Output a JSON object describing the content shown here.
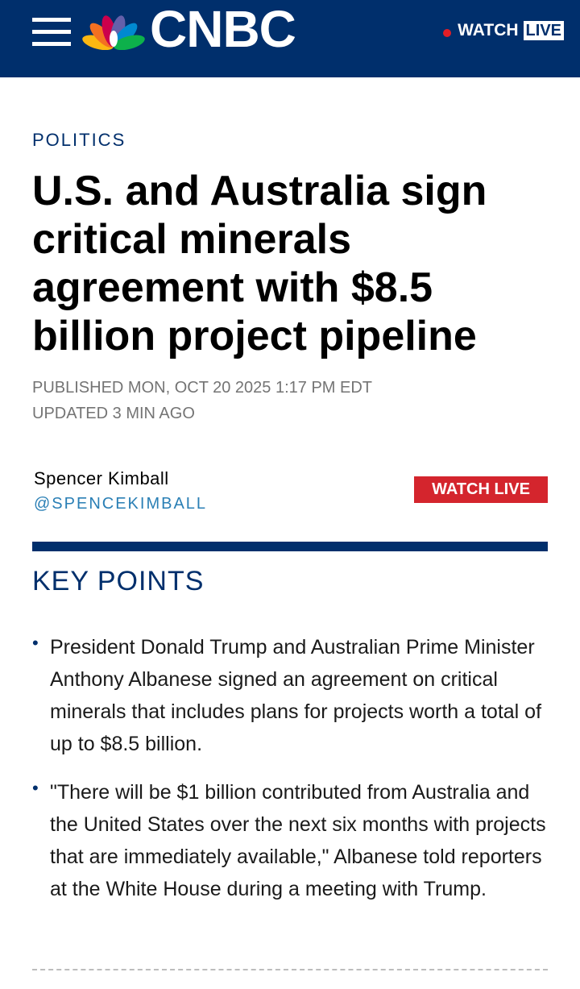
{
  "header": {
    "logo_text": "CNBC",
    "watch_label": "WATCH",
    "live_label": "LIVE"
  },
  "article": {
    "section": "POLITICS",
    "headline": "U.S. and Australia sign critical minerals agreement with $8.5 billion project pipeline",
    "published": "PUBLISHED MON, OCT 20 2025 1:17 PM EDT",
    "updated": "UPDATED 3 MIN AGO",
    "author_name": "Spencer Kimball",
    "author_handle": "@SPENCEKIMBALL",
    "watch_live_button": "WATCH LIVE"
  },
  "key_points": {
    "title": "KEY POINTS",
    "items": [
      "President Donald Trump and Australian Prime Minister Anthony Albanese signed an agreement on critical minerals that includes plans for projects worth a total of up to $8.5 billion.",
      "\"There will be $1 billion contributed from Australia and the United States over the next six months with projects that are immediately available,\" Albanese told reporters at the White House during a meeting with Trump."
    ]
  },
  "colors": {
    "brand_navy": "#002f6c",
    "live_red": "#d4252d",
    "handle_blue": "#2a7fb5"
  },
  "icons": {
    "menu": "hamburger-menu-icon",
    "logo": "cnbc-peacock-logo",
    "live_indicator": "red-dot-icon"
  }
}
